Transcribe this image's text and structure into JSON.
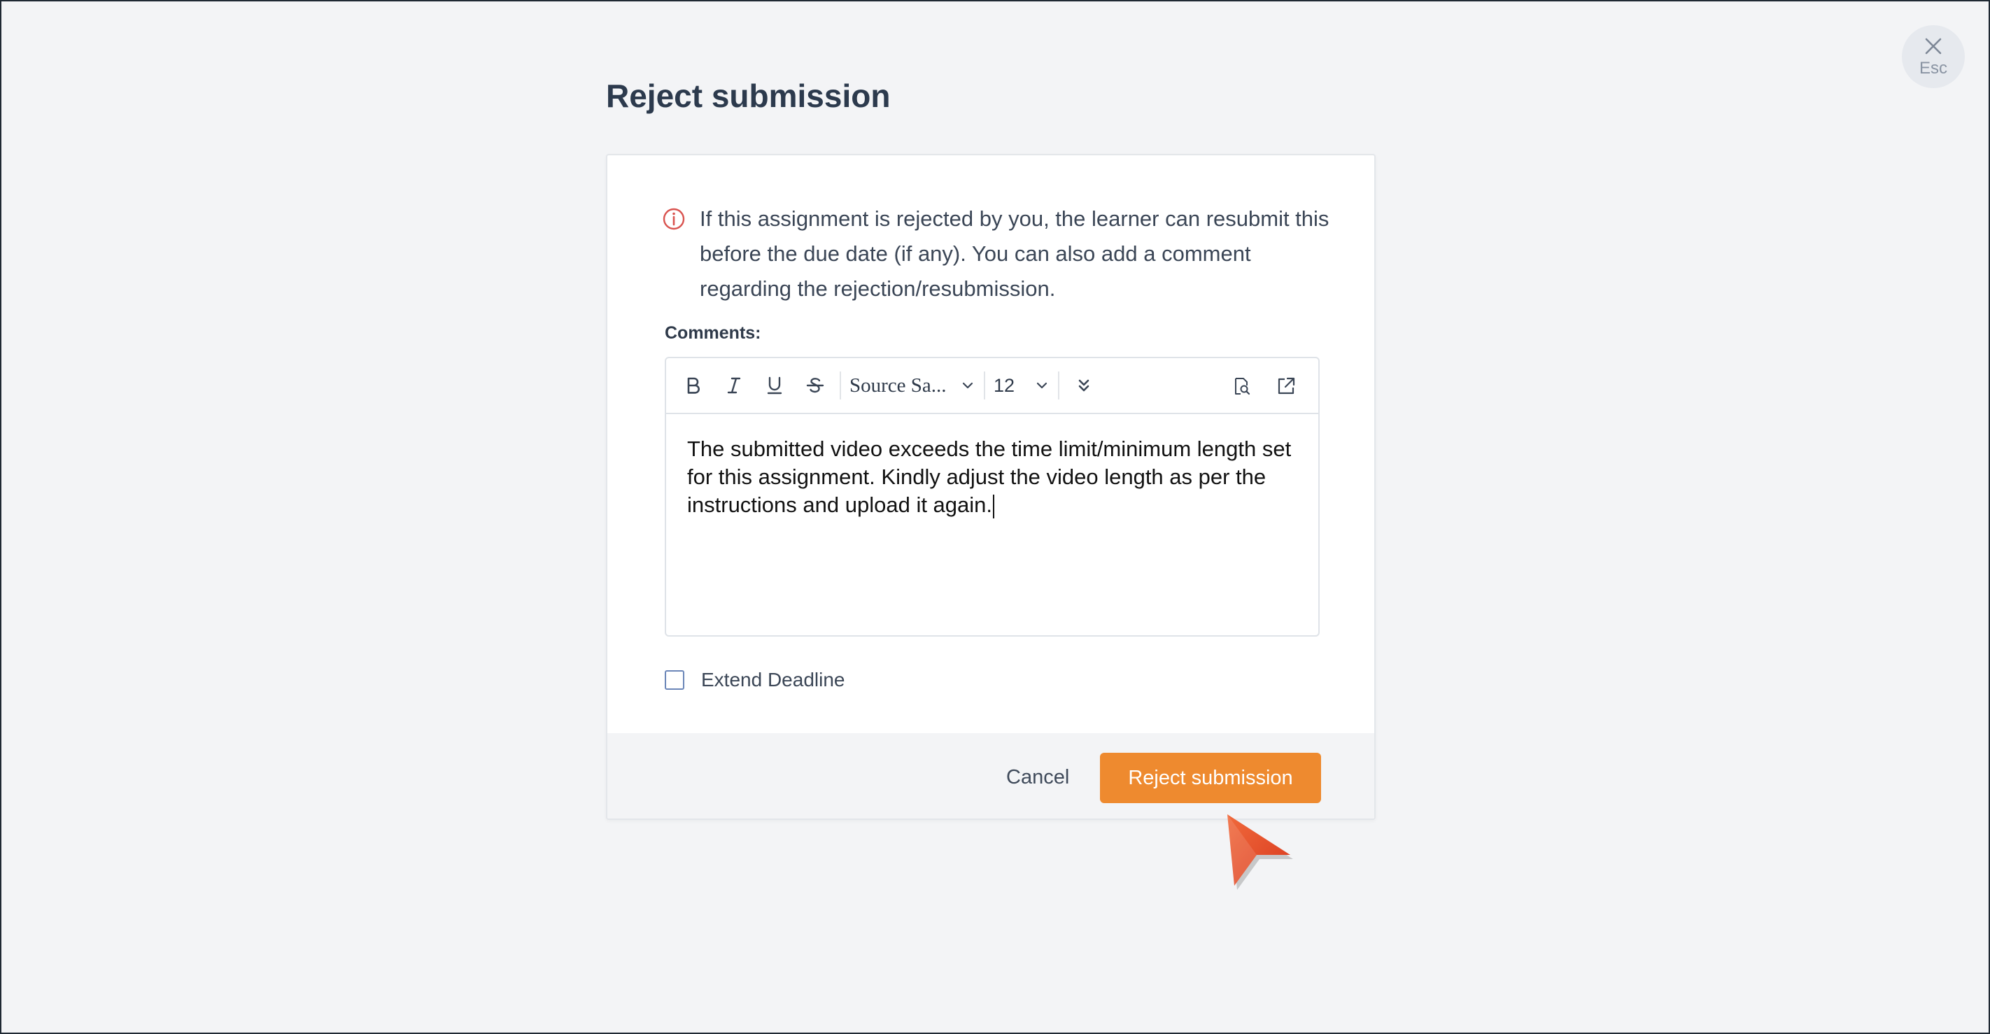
{
  "close": {
    "esc_label": "Esc"
  },
  "page": {
    "title": "Reject submission"
  },
  "info": {
    "text": "If this assignment is rejected by you, the learner can resubmit this before the due date (if any). You can also add a comment regarding the rejection/resubmission."
  },
  "comments": {
    "label": "Comments:",
    "toolbar": {
      "font_family": "Source  Sa...",
      "font_size": "12"
    },
    "body": "The submitted video exceeds the time limit/minimum length set for this assignment. Kindly adjust the video length as per the instructions and upload it again."
  },
  "extend_deadline": {
    "label": "Extend Deadline",
    "checked": false
  },
  "footer": {
    "cancel_label": "Cancel",
    "reject_label": "Reject submission"
  },
  "colors": {
    "accent": "#ee8a2f",
    "info_icon": "#d9534f",
    "background": "#f3f4f6"
  },
  "icons": {
    "close": "close-icon",
    "info": "info-icon",
    "bold": "bold-icon",
    "italic": "italic-icon",
    "underline": "underline-icon",
    "strikethrough": "strikethrough-icon",
    "more": "double-chevron-down-icon",
    "preview": "preview-document-icon",
    "open": "external-link-icon"
  }
}
